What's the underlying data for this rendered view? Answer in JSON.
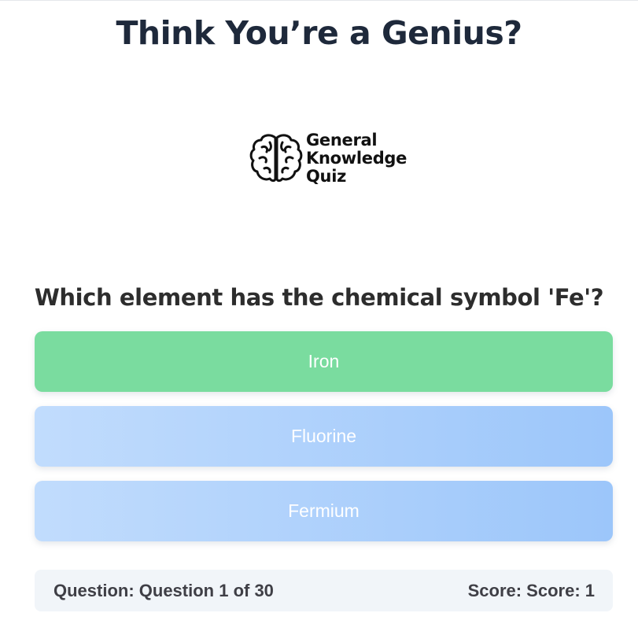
{
  "header": {
    "title": "Think You’re a Genius?"
  },
  "logo": {
    "icon": "brain-icon",
    "lines": [
      "General",
      "Knowledge",
      "Quiz"
    ]
  },
  "quiz": {
    "question": "Which element has the chemical symbol 'Fe'?",
    "answers": [
      {
        "label": "Iron",
        "state": "correct"
      },
      {
        "label": "Fluorine",
        "state": "neutral"
      },
      {
        "label": "Fermium",
        "state": "neutral"
      }
    ]
  },
  "status": {
    "question_progress": "Question: Question 1 of 30",
    "score": "Score: Score: 1"
  },
  "colors": {
    "correct": "#7adc9f",
    "neutral_start": "#c1dcfd",
    "neutral_end": "#9cc6fa",
    "status_bg": "#f1f5f9",
    "title": "#1e293b"
  }
}
